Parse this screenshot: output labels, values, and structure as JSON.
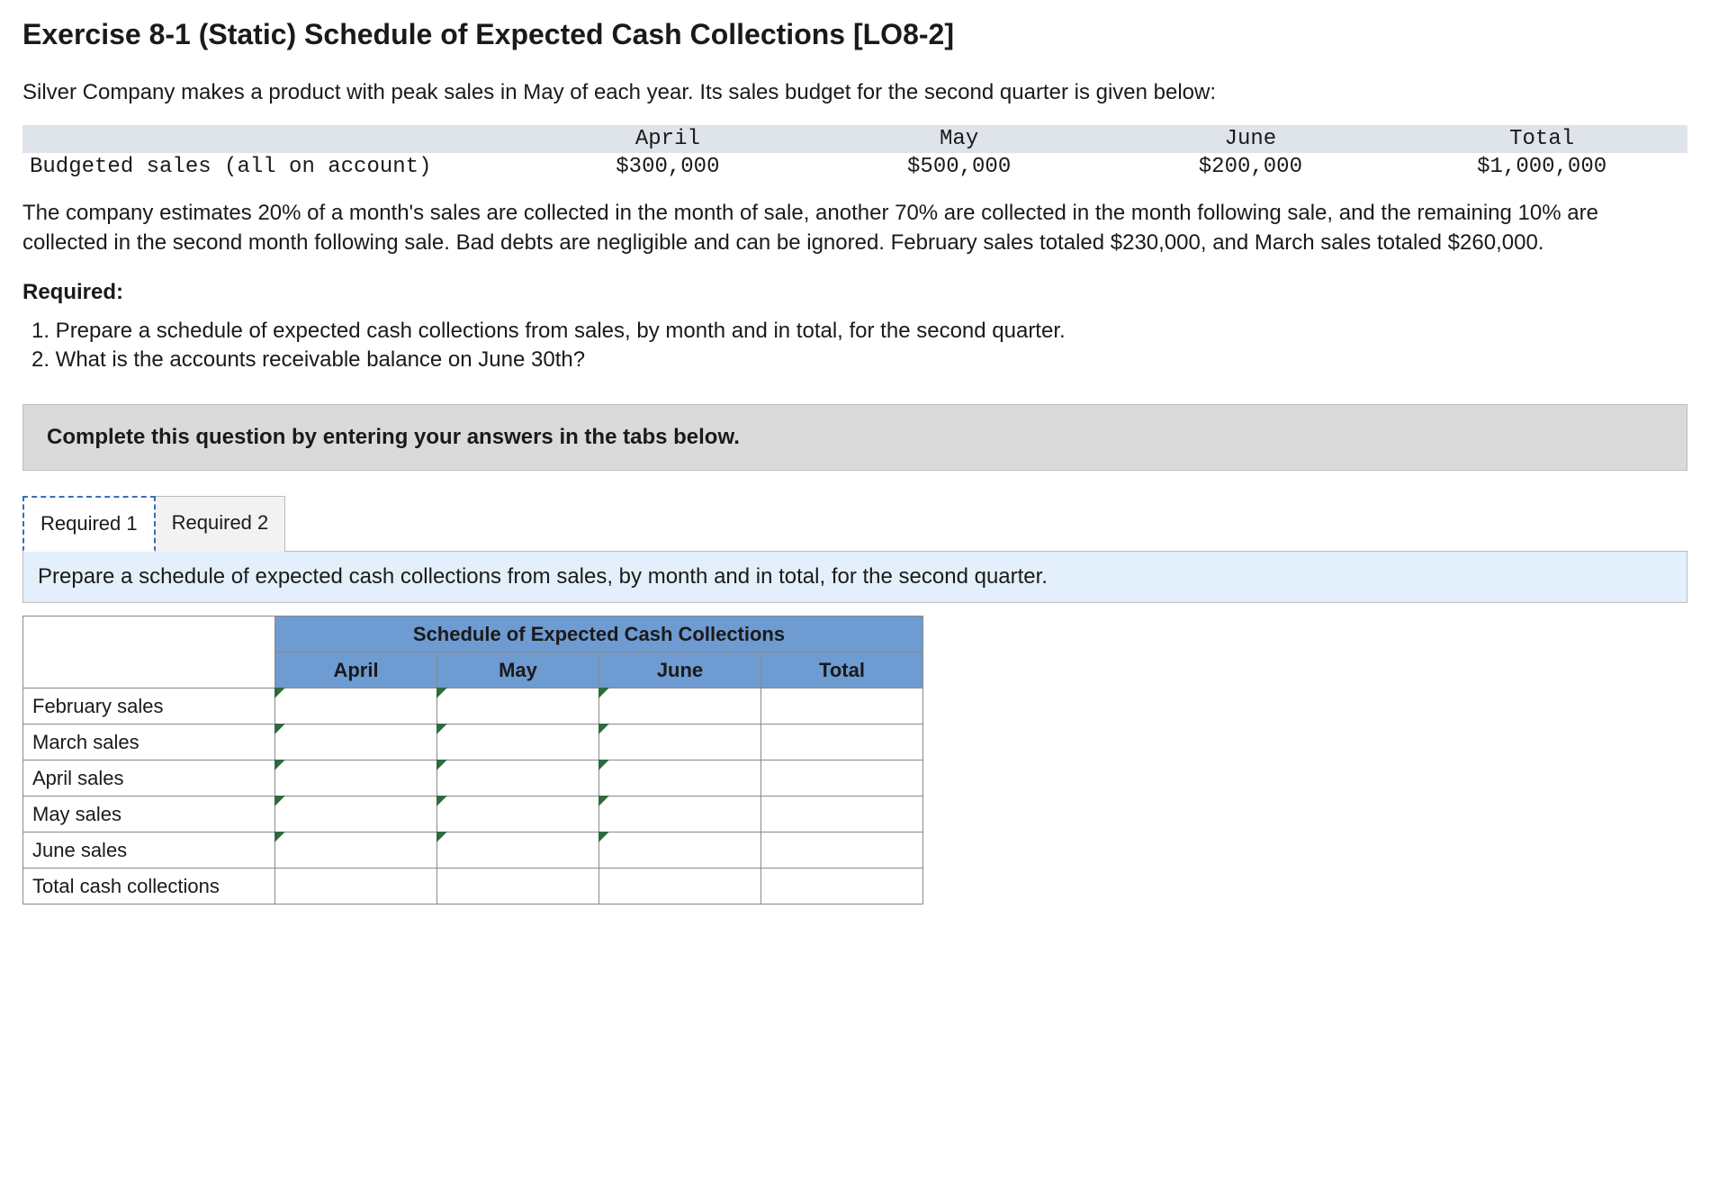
{
  "title": "Exercise 8-1 (Static) Schedule of Expected Cash Collections [LO8-2]",
  "intro": "Silver Company makes a product with peak sales in May of each year. Its sales budget for the second quarter is given below:",
  "budget": {
    "row_label": "Budgeted sales (all on account)",
    "columns": [
      "April",
      "May",
      "June",
      "Total"
    ],
    "values": [
      "$300,000",
      "$500,000",
      "$200,000",
      "$1,000,000"
    ]
  },
  "explain": "The company estimates 20% of a month's sales are collected in the month of sale, another 70% are collected in the month following sale, and the remaining 10% are collected in the second month following sale. Bad debts are negligible and can be ignored. February sales totaled $230,000, and March sales totaled $260,000.",
  "required_heading": "Required:",
  "required_items": [
    "1. Prepare a schedule of expected cash collections from sales, by month and in total, for the second quarter.",
    "2. What is the accounts receivable balance on June 30th?"
  ],
  "instruction_bar": "Complete this question by entering your answers in the tabs below.",
  "tabs": {
    "tab1": "Required 1",
    "tab2": "Required 2"
  },
  "tab_prompt": "Prepare a schedule of expected cash collections from sales, by month and in total, for the second quarter.",
  "answer_table": {
    "title": "Schedule of Expected Cash Collections",
    "col_headers": [
      "April",
      "May",
      "June",
      "Total"
    ],
    "row_labels": [
      "February sales",
      "March sales",
      "April sales",
      "May sales",
      "June sales",
      "Total cash collections"
    ]
  },
  "chart_data": {
    "type": "table",
    "title": "Schedule of Expected Cash Collections",
    "columns": [
      "April",
      "May",
      "June",
      "Total"
    ],
    "rows": [
      "February sales",
      "March sales",
      "April sales",
      "May sales",
      "June sales",
      "Total cash collections"
    ],
    "values": [
      [
        null,
        null,
        null,
        null
      ],
      [
        null,
        null,
        null,
        null
      ],
      [
        null,
        null,
        null,
        null
      ],
      [
        null,
        null,
        null,
        null
      ],
      [
        null,
        null,
        null,
        null
      ],
      [
        null,
        null,
        null,
        null
      ]
    ]
  }
}
